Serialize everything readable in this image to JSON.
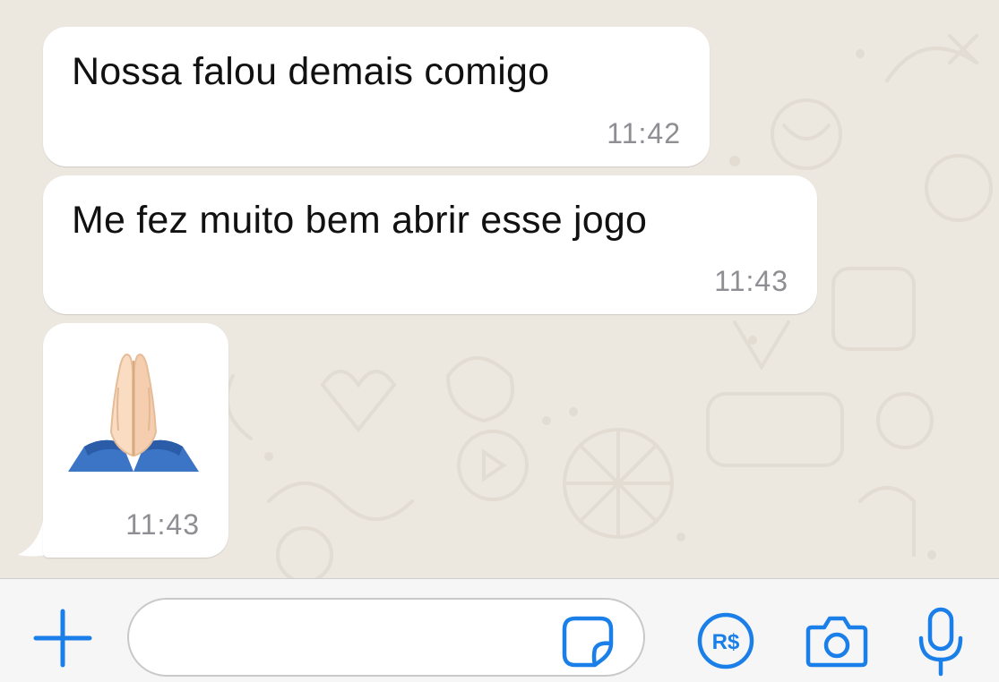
{
  "messages": [
    {
      "text": "Nossa falou demais comigo",
      "time": "11:42"
    },
    {
      "text": "Me fez muito bem abrir esse jogo",
      "time": "11:43"
    },
    {
      "emoji": "folded-hands",
      "time": "11:43"
    }
  ],
  "input_bar": {
    "message_value": "",
    "icons": [
      "plus-icon",
      "sticker-icon",
      "payment-icon",
      "camera-icon",
      "microphone-icon"
    ],
    "payment_label": "R$"
  },
  "colors": {
    "accent": "#1a7fe8",
    "wallpaper": "#ece7df",
    "bubble": "#ffffff",
    "timestamp": "#8e8e93"
  }
}
